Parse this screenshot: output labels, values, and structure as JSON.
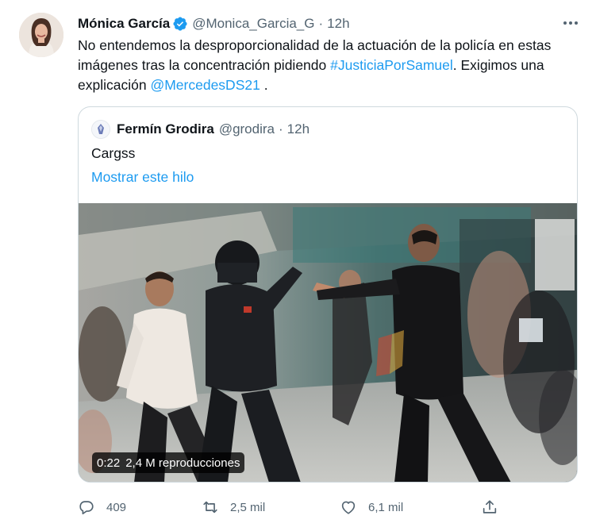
{
  "tweet": {
    "author_name": "Mónica García",
    "verified_icon": "verified-badge-icon",
    "handle": "@Monica_Garcia_G",
    "separator": "·",
    "time": "12h",
    "text_plain": "No entendemos la desproporcionalidad de la actuación de la policía en estas imágenes tras la concentración pidiendo ",
    "hashtag": "#JusticiaPorSamuel",
    "text_mid": ". Exigimos una explicación ",
    "mention": "@MercedesDS21",
    "text_end": " ."
  },
  "quote": {
    "author_name": "Fermín Grodira",
    "handle": "@grodira",
    "separator": "·",
    "time": "12h",
    "text": "Cargss",
    "thread_link": "Mostrar este hilo"
  },
  "video": {
    "duration": "0:22",
    "views": "2,4 M reproducciones"
  },
  "actions": {
    "reply_count": "409",
    "retweet_count": "2,5 mil",
    "like_count": "6,1 mil"
  },
  "colors": {
    "link": "#1d9bf0",
    "muted": "#536471",
    "text": "#0f1419",
    "border": "#cfd9de"
  }
}
